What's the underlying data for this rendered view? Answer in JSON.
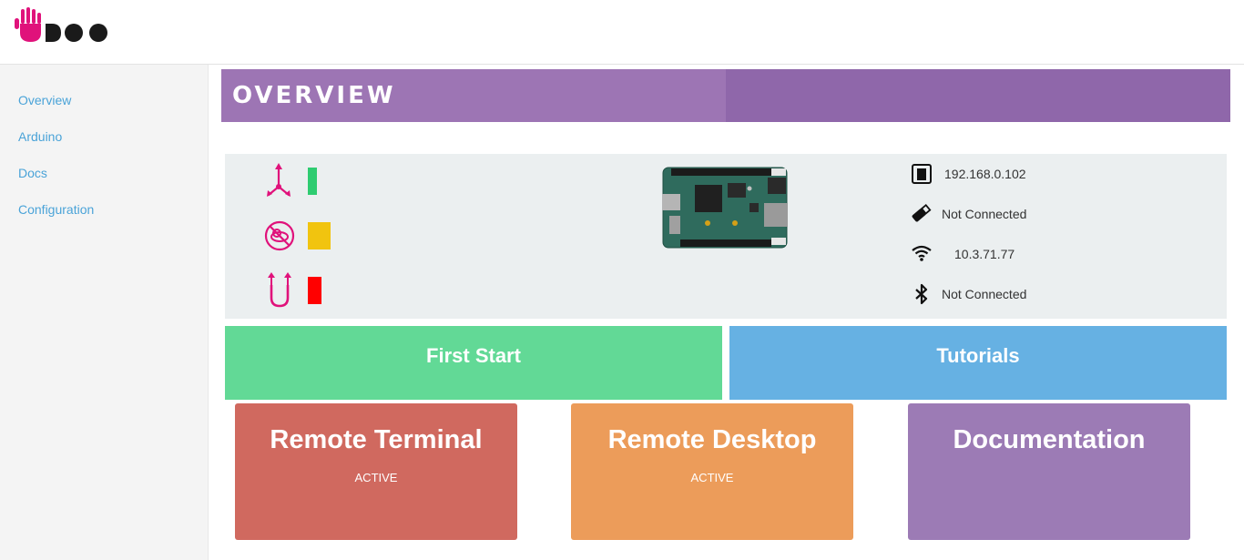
{
  "brand": {
    "logo_alt": "UDOO",
    "accent": "#e0127b"
  },
  "sidebar": {
    "items": [
      {
        "label": "Overview"
      },
      {
        "label": "Arduino"
      },
      {
        "label": "Docs"
      },
      {
        "label": "Configuration"
      }
    ],
    "link_color": "#4aa3d8"
  },
  "page": {
    "title": "OVERVIEW",
    "title_color": "#9d75b4"
  },
  "status": {
    "indicators": [
      {
        "icon": "sensors-icon",
        "level_color": "#2ecc71"
      },
      {
        "icon": "no-cloud-icon",
        "level_color": "#f1c40f"
      },
      {
        "icon": "usb-connection-icon",
        "level_color": "#ff0000"
      }
    ],
    "network": {
      "ethernet": {
        "icon": "ethernet-icon",
        "value": "192.168.0.102"
      },
      "usb": {
        "icon": "usb-drive-icon",
        "value": "Not Connected"
      },
      "wifi": {
        "icon": "wifi-icon",
        "value": "10.3.71.77"
      },
      "bluetooth": {
        "icon": "bluetooth-icon",
        "value": "Not Connected"
      }
    }
  },
  "quick": {
    "first_start": {
      "label": "First Start",
      "color": "#62d996"
    },
    "tutorials": {
      "label": "Tutorials",
      "color": "#66b1e3"
    }
  },
  "cards": {
    "remote_terminal": {
      "title": "Remote Terminal",
      "status": "ACTIVE",
      "color": "#d0695f"
    },
    "remote_desktop": {
      "title": "Remote Desktop",
      "status": "ACTIVE",
      "color": "#ec9c5a"
    },
    "documentation": {
      "title": "Documentation",
      "color": "#9c7bb5"
    }
  }
}
